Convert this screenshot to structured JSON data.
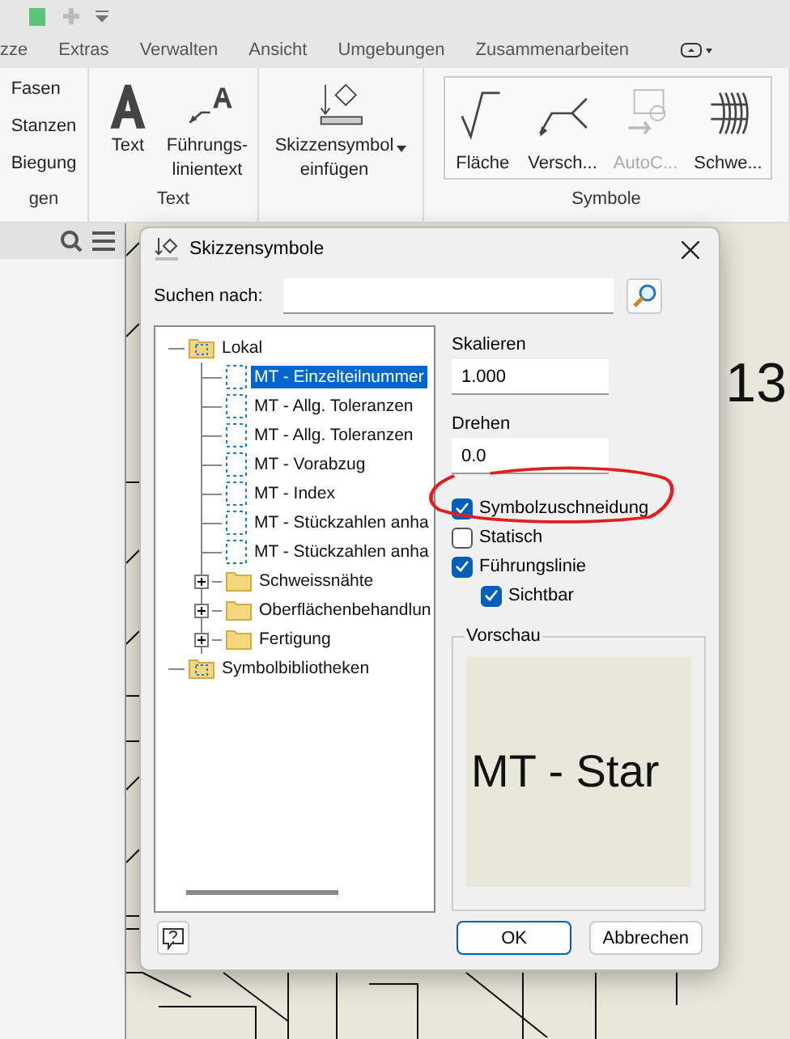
{
  "ribbon": {
    "tabs": [
      {
        "label": "zze",
        "selected": false
      },
      {
        "label": "Extras",
        "selected": false
      },
      {
        "label": "Verwalten",
        "selected": false
      },
      {
        "label": "Ansicht",
        "selected": false
      },
      {
        "label": "Umgebungen",
        "selected": false
      },
      {
        "label": "Zusammenarbeiten",
        "selected": false
      }
    ],
    "panels": [
      {
        "label": "gen",
        "kind": "list",
        "items": [
          {
            "label": "Fasen",
            "disabled": false
          },
          {
            "label": "Stanzen",
            "disabled": false
          },
          {
            "label": "Biegung",
            "disabled": false
          }
        ]
      },
      {
        "label": "Text",
        "kind": "large",
        "items": [
          {
            "label": "Text",
            "kind": "text",
            "disabled": false
          },
          {
            "label": "Führungs-\nlinientext",
            "kind": "leader",
            "disabled": false
          }
        ]
      },
      {
        "kind": "large",
        "items": [
          {
            "label": "Skizzensymbol\neinfügen",
            "kind": "sketch",
            "disabled": false,
            "dropdown": true
          }
        ]
      },
      {
        "label": "Symbole",
        "kind": "gallery",
        "items": [
          {
            "label": "Fläche",
            "kind": "surface",
            "disabled": false
          },
          {
            "label": "Versch...",
            "kind": "weld",
            "disabled": false
          },
          {
            "label": "AutoC...",
            "kind": "datum",
            "disabled": true
          },
          {
            "label": "Schwe...",
            "kind": "bead",
            "disabled": false
          }
        ]
      }
    ]
  },
  "canvas": {
    "labels": [
      {
        "text": "13"
      }
    ]
  },
  "dialog": {
    "title": "Skizzensymbole",
    "search": {
      "label": "Suchen nach:"
    },
    "tree": [
      {
        "label": "Lokal",
        "kind": "library",
        "expanded": true,
        "selected": false,
        "children": [
          {
            "label": "MT - Einzelteilnummer",
            "kind": "symbol",
            "selected": true
          },
          {
            "label": "MT - Allg. Toleranzen",
            "kind": "symbol",
            "selected": false
          },
          {
            "label": "MT - Allg. Toleranzen",
            "kind": "symbol",
            "selected": false
          },
          {
            "label": "MT - Vorabzug",
            "kind": "symbol",
            "selected": false
          },
          {
            "label": "MT - Index",
            "kind": "symbol",
            "selected": false
          },
          {
            "label": "MT - Stückzahlen anha",
            "kind": "symbol",
            "selected": false
          },
          {
            "label": "MT - Stückzahlen anha",
            "kind": "symbol",
            "selected": false
          },
          {
            "label": "Schweissnähte",
            "kind": "folder",
            "expanded": false,
            "selected": false
          },
          {
            "label": "Oberflächenbehandlun",
            "kind": "folder",
            "expanded": false,
            "selected": false
          },
          {
            "label": "Fertigung",
            "kind": "folder",
            "expanded": false,
            "selected": false
          }
        ]
      },
      {
        "label": "Symbolbibliotheken",
        "kind": "library",
        "selected": false
      }
    ],
    "scale": {
      "label": "Skalieren",
      "value": "1.000"
    },
    "rotate": {
      "label": "Drehen",
      "value": "0.0"
    },
    "options": [
      {
        "label": "Symbolzuschneidung",
        "checked": true,
        "highlighted": true
      },
      {
        "label": "Statisch",
        "checked": false
      },
      {
        "label": "Führungslinie",
        "checked": true,
        "children": [
          {
            "label": "Sichtbar",
            "checked": true
          }
        ]
      }
    ],
    "preview": {
      "label": "Vorschau",
      "text": "MT - Star"
    },
    "buttons": [
      {
        "label": "OK",
        "kind": "primary"
      },
      {
        "label": "Abbrechen",
        "kind": "secondary"
      }
    ]
  }
}
